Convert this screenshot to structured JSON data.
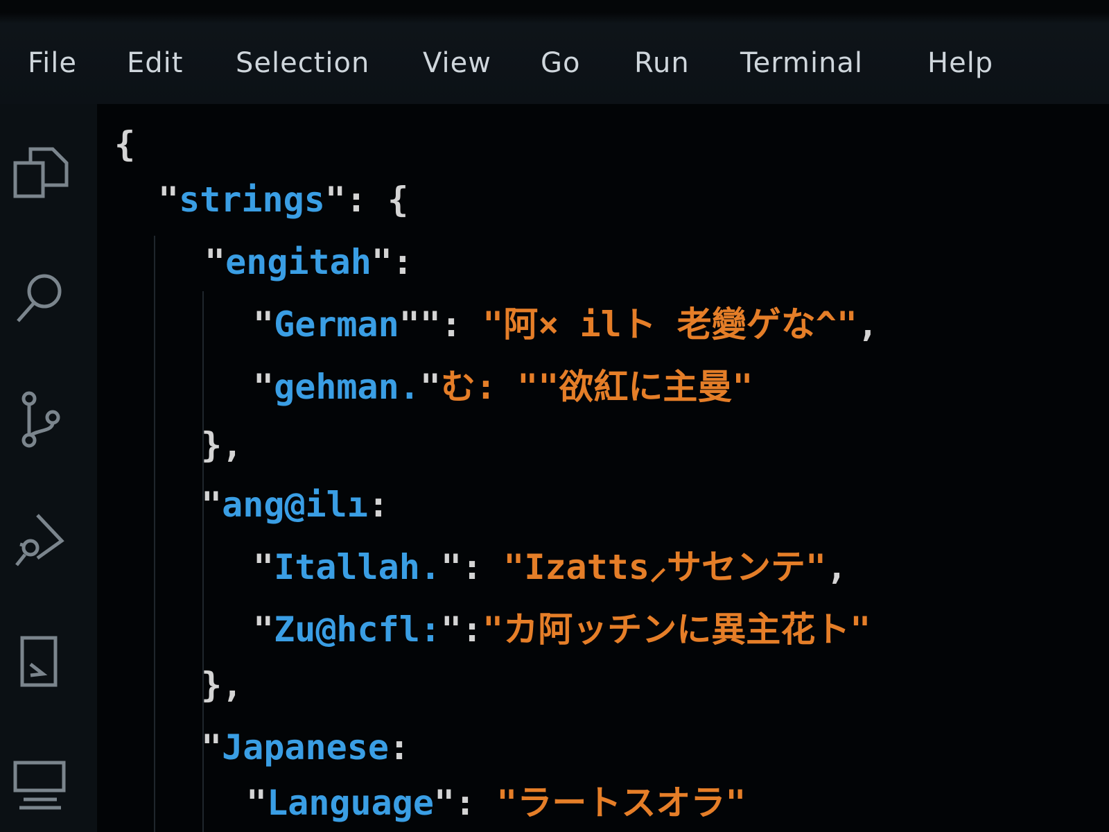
{
  "menubar": {
    "items": [
      "File",
      "Edit",
      "Selection",
      "View",
      "Go",
      "Run",
      "Terminal",
      "Help"
    ]
  },
  "activitybar": {
    "icons": [
      "explorer-icon",
      "search-icon",
      "source-control-icon",
      "run-debug-icon",
      "extensions-icon",
      "remote-explorer-icon"
    ]
  },
  "colors": {
    "menubar_bg": "#0c1116",
    "editor_bg": "#020406",
    "key": "#3a9ee4",
    "string": "#e57e28",
    "punctuation": "#d4d4d4"
  },
  "editor": {
    "lines": [
      {
        "name": "line-root-open",
        "tokens": [
          {
            "t": "punc",
            "v": "{"
          }
        ]
      },
      {
        "name": "line-strings-key",
        "tokens": [
          {
            "t": "punc",
            "v": "\""
          },
          {
            "t": "key",
            "v": "strings"
          },
          {
            "t": "punc",
            "v": "\": {"
          }
        ]
      },
      {
        "name": "line-engitah-key",
        "tokens": [
          {
            "t": "punc",
            "v": "\""
          },
          {
            "t": "key",
            "v": "engitah"
          },
          {
            "t": "punc",
            "v": "\":"
          }
        ]
      },
      {
        "name": "line-german",
        "tokens": [
          {
            "t": "punc",
            "v": "\""
          },
          {
            "t": "key",
            "v": "German"
          },
          {
            "t": "punc",
            "v": "\"\": "
          },
          {
            "t": "str",
            "v": "\"阿× ilト 老變ゲな^\""
          },
          {
            "t": "punc",
            "v": ","
          }
        ]
      },
      {
        "name": "line-gehman",
        "tokens": [
          {
            "t": "punc",
            "v": "\""
          },
          {
            "t": "key",
            "v": "gehman."
          },
          {
            "t": "punc",
            "v": "\""
          },
          {
            "t": "str",
            "v": "む: \"\"欲紅に主曼\""
          }
        ]
      },
      {
        "name": "line-close-1",
        "tokens": [
          {
            "t": "punc",
            "v": "},"
          }
        ]
      },
      {
        "name": "line-angili-key",
        "tokens": [
          {
            "t": "punc",
            "v": "\""
          },
          {
            "t": "key",
            "v": "ang@ilı"
          },
          {
            "t": "punc",
            "v": ":"
          }
        ]
      },
      {
        "name": "line-itallah",
        "tokens": [
          {
            "t": "punc",
            "v": "\""
          },
          {
            "t": "key",
            "v": "Itallah."
          },
          {
            "t": "punc",
            "v": "\": "
          },
          {
            "t": "str",
            "v": "\"Izatts⸝サセンテ\""
          },
          {
            "t": "punc",
            "v": ","
          }
        ]
      },
      {
        "name": "line-zuhcfl",
        "tokens": [
          {
            "t": "punc",
            "v": "\""
          },
          {
            "t": "key",
            "v": "Zu@hcfl:"
          },
          {
            "t": "punc",
            "v": "\":"
          },
          {
            "t": "str",
            "v": "\"カ阿ッチンに異主花ト\""
          }
        ]
      },
      {
        "name": "line-close-2",
        "tokens": [
          {
            "t": "punc",
            "v": "},"
          }
        ]
      },
      {
        "name": "line-japanese-key",
        "tokens": [
          {
            "t": "punc",
            "v": "\""
          },
          {
            "t": "key",
            "v": "Japanese"
          },
          {
            "t": "punc",
            "v": ":"
          }
        ]
      },
      {
        "name": "line-language",
        "tokens": [
          {
            "t": "punc",
            "v": "\""
          },
          {
            "t": "key",
            "v": "Language"
          },
          {
            "t": "punc",
            "v": "\": "
          },
          {
            "t": "str",
            "v": "\"ラートスオラ\""
          }
        ]
      }
    ]
  }
}
